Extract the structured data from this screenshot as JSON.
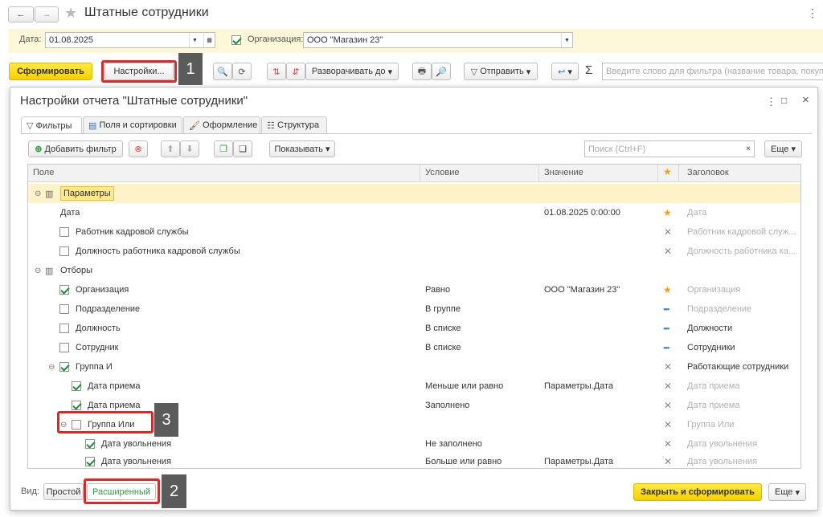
{
  "window": {
    "title": "Штатные сотрудники"
  },
  "params": {
    "date_label": "Дата:",
    "date_value": "01.08.2025",
    "org_label": "Организация:",
    "org_value": "ООО \"Магазин 23\""
  },
  "toolbar": {
    "generate": "Сформировать",
    "settings": "Настройки...",
    "expand": "Разворачивать до",
    "send": "Отправить",
    "filter_placeholder": "Введите слово для фильтра (название товара, покупате"
  },
  "dialog": {
    "title": "Настройки отчета \"Штатные сотрудники\"",
    "tabs": [
      "Фильтры",
      "Поля и сортировки",
      "Оформление",
      "Структура"
    ],
    "add_filter": "Добавить фильтр",
    "show": "Показывать",
    "search_placeholder": "Поиск (Ctrl+F)",
    "more": "Еще",
    "columns": [
      "Поле",
      "Условие",
      "Значение",
      "Заголовок"
    ],
    "rows": [
      {
        "field": "Параметры",
        "cond": "",
        "value": "",
        "title": ""
      },
      {
        "field": "Дата",
        "cond": "",
        "value": "01.08.2025 0:00:00",
        "title": "Дата"
      },
      {
        "field": "Работник кадровой службы",
        "cond": "",
        "value": "",
        "title": "Работник кадровой служ..."
      },
      {
        "field": "Должность работника кадровой службы",
        "cond": "",
        "value": "",
        "title": "Должность работника ка..."
      },
      {
        "field": "Отборы",
        "cond": "",
        "value": "",
        "title": ""
      },
      {
        "field": "Организация",
        "cond": "Равно",
        "value": "ООО \"Магазин 23\"",
        "title": "Организация"
      },
      {
        "field": "Подразделение",
        "cond": "В группе",
        "value": "",
        "title": "Подразделение"
      },
      {
        "field": "Должность",
        "cond": "В списке",
        "value": "",
        "title": "Должности"
      },
      {
        "field": "Сотрудник",
        "cond": "В списке",
        "value": "",
        "title": "Сотрудники"
      },
      {
        "field": "Группа И",
        "cond": "",
        "value": "",
        "title": "Работающие сотрудники"
      },
      {
        "field": "Дата приема",
        "cond": "Меньше или равно",
        "value": "Параметры.Дата",
        "title": "Дата приема"
      },
      {
        "field": "Дата приема",
        "cond": "Заполнено",
        "value": "",
        "title": "Дата приема"
      },
      {
        "field": "Группа Или",
        "cond": "",
        "value": "",
        "title": "Группа Или"
      },
      {
        "field": "Дата увольнения",
        "cond": "Не заполнено",
        "value": "",
        "title": "Дата увольнения"
      },
      {
        "field": "Дата увольнения",
        "cond": "Больше или равно",
        "value": "Параметры.Дата",
        "title": "Дата увольнения"
      }
    ],
    "view_label": "Вид:",
    "simple": "Простой",
    "extended": "Расширенный",
    "close_generate": "Закрыть и сформировать"
  },
  "callouts": [
    "1",
    "2",
    "3"
  ]
}
